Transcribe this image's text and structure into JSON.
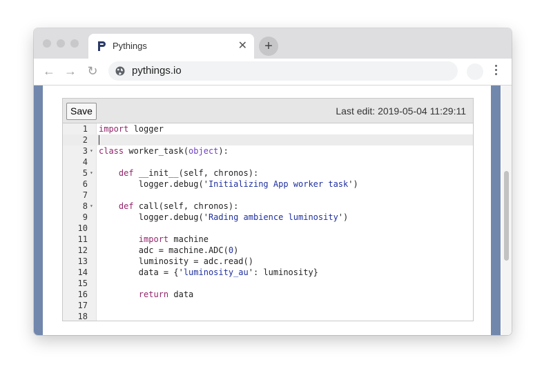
{
  "browser": {
    "tab_title": "Pythings",
    "tab_close": "✕",
    "new_tab": "+",
    "url": "pythings.io",
    "nav": {
      "back": "←",
      "forward": "→",
      "reload": "↻"
    }
  },
  "editor": {
    "save_label": "Save",
    "last_edit": "Last edit: 2019-05-04 11:29:11",
    "lines": [
      {
        "n": "1",
        "fold": "",
        "text": "import logger"
      },
      {
        "n": "2",
        "fold": "",
        "text": ""
      },
      {
        "n": "3",
        "fold": "▾",
        "text": "class worker_task(object):"
      },
      {
        "n": "4",
        "fold": "",
        "text": ""
      },
      {
        "n": "5",
        "fold": "▾",
        "text": "    def __init__(self, chronos):"
      },
      {
        "n": "6",
        "fold": "",
        "text": "        logger.debug('Initializing App worker task')"
      },
      {
        "n": "7",
        "fold": "",
        "text": ""
      },
      {
        "n": "8",
        "fold": "▾",
        "text": "    def call(self, chronos):"
      },
      {
        "n": "9",
        "fold": "",
        "text": "        logger.debug('Rading ambience luminosity')"
      },
      {
        "n": "10",
        "fold": "",
        "text": ""
      },
      {
        "n": "11",
        "fold": "",
        "text": "        import machine"
      },
      {
        "n": "12",
        "fold": "",
        "text": "        adc = machine.ADC(0)"
      },
      {
        "n": "13",
        "fold": "",
        "text": "        luminosity = adc.read()"
      },
      {
        "n": "14",
        "fold": "",
        "text": "        data = {'luminosity_au': luminosity}"
      },
      {
        "n": "15",
        "fold": "",
        "text": ""
      },
      {
        "n": "16",
        "fold": "",
        "text": "        return data"
      },
      {
        "n": "17",
        "fold": "",
        "text": ""
      },
      {
        "n": "18",
        "fold": "",
        "text": ""
      }
    ],
    "active_line": 2
  },
  "colors": {
    "side_panel": "#7187ac",
    "keyword": "#93256b",
    "string": "#1f30a0",
    "builtin": "#6f42c1"
  }
}
